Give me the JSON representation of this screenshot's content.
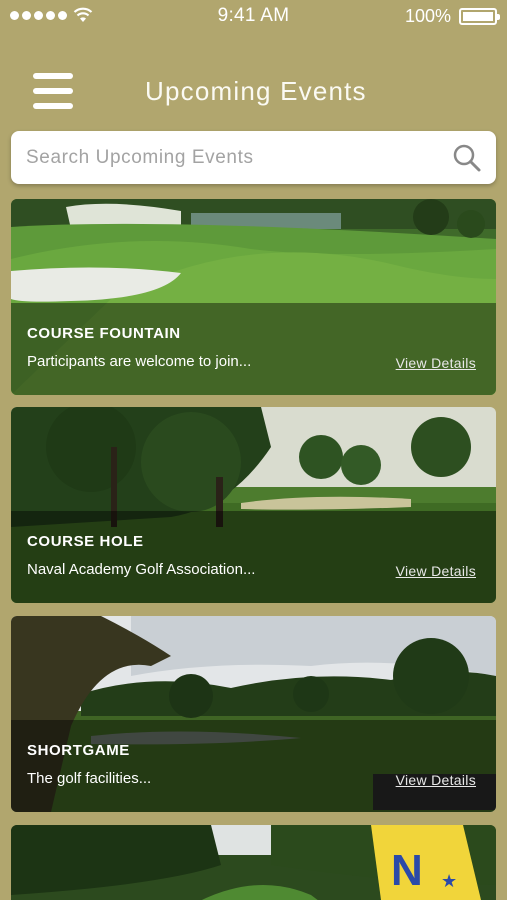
{
  "status_bar": {
    "time": "9:41 AM",
    "battery": "100%",
    "battery_level": 1.0
  },
  "header": {
    "menu_icon": "hamburger-menu-icon",
    "title": "Upcoming Events"
  },
  "search": {
    "placeholder": "Search Upcoming Events",
    "value": "",
    "icon": "search-icon"
  },
  "events": [
    {
      "title": "COURSE FOUNTAIN",
      "description": "Participants are welcome to join...",
      "link": "View Details"
    },
    {
      "title": "COURSE HOLE",
      "description": "Naval Academy Golf Association...",
      "link": "View Details"
    },
    {
      "title": "SHORTGAME",
      "description": "The golf facilities...",
      "link": "View Details"
    }
  ],
  "colors": {
    "background": "#b1a66e",
    "card_overlay": "rgba(0,0,0,0.42)",
    "text": "#ffffff"
  }
}
